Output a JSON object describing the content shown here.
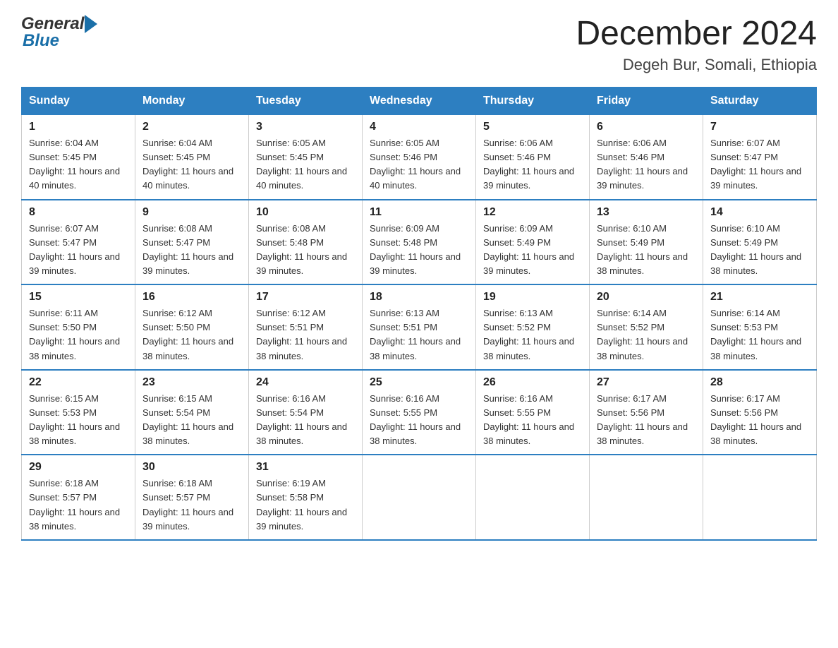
{
  "header": {
    "logo_text1": "General",
    "logo_text2": "Blue",
    "title": "December 2024",
    "subtitle": "Degeh Bur, Somali, Ethiopia"
  },
  "calendar": {
    "days_of_week": [
      "Sunday",
      "Monday",
      "Tuesday",
      "Wednesday",
      "Thursday",
      "Friday",
      "Saturday"
    ],
    "weeks": [
      [
        {
          "day": "1",
          "sunrise": "6:04 AM",
          "sunset": "5:45 PM",
          "daylight": "11 hours and 40 minutes."
        },
        {
          "day": "2",
          "sunrise": "6:04 AM",
          "sunset": "5:45 PM",
          "daylight": "11 hours and 40 minutes."
        },
        {
          "day": "3",
          "sunrise": "6:05 AM",
          "sunset": "5:45 PM",
          "daylight": "11 hours and 40 minutes."
        },
        {
          "day": "4",
          "sunrise": "6:05 AM",
          "sunset": "5:46 PM",
          "daylight": "11 hours and 40 minutes."
        },
        {
          "day": "5",
          "sunrise": "6:06 AM",
          "sunset": "5:46 PM",
          "daylight": "11 hours and 39 minutes."
        },
        {
          "day": "6",
          "sunrise": "6:06 AM",
          "sunset": "5:46 PM",
          "daylight": "11 hours and 39 minutes."
        },
        {
          "day": "7",
          "sunrise": "6:07 AM",
          "sunset": "5:47 PM",
          "daylight": "11 hours and 39 minutes."
        }
      ],
      [
        {
          "day": "8",
          "sunrise": "6:07 AM",
          "sunset": "5:47 PM",
          "daylight": "11 hours and 39 minutes."
        },
        {
          "day": "9",
          "sunrise": "6:08 AM",
          "sunset": "5:47 PM",
          "daylight": "11 hours and 39 minutes."
        },
        {
          "day": "10",
          "sunrise": "6:08 AM",
          "sunset": "5:48 PM",
          "daylight": "11 hours and 39 minutes."
        },
        {
          "day": "11",
          "sunrise": "6:09 AM",
          "sunset": "5:48 PM",
          "daylight": "11 hours and 39 minutes."
        },
        {
          "day": "12",
          "sunrise": "6:09 AM",
          "sunset": "5:49 PM",
          "daylight": "11 hours and 39 minutes."
        },
        {
          "day": "13",
          "sunrise": "6:10 AM",
          "sunset": "5:49 PM",
          "daylight": "11 hours and 38 minutes."
        },
        {
          "day": "14",
          "sunrise": "6:10 AM",
          "sunset": "5:49 PM",
          "daylight": "11 hours and 38 minutes."
        }
      ],
      [
        {
          "day": "15",
          "sunrise": "6:11 AM",
          "sunset": "5:50 PM",
          "daylight": "11 hours and 38 minutes."
        },
        {
          "day": "16",
          "sunrise": "6:12 AM",
          "sunset": "5:50 PM",
          "daylight": "11 hours and 38 minutes."
        },
        {
          "day": "17",
          "sunrise": "6:12 AM",
          "sunset": "5:51 PM",
          "daylight": "11 hours and 38 minutes."
        },
        {
          "day": "18",
          "sunrise": "6:13 AM",
          "sunset": "5:51 PM",
          "daylight": "11 hours and 38 minutes."
        },
        {
          "day": "19",
          "sunrise": "6:13 AM",
          "sunset": "5:52 PM",
          "daylight": "11 hours and 38 minutes."
        },
        {
          "day": "20",
          "sunrise": "6:14 AM",
          "sunset": "5:52 PM",
          "daylight": "11 hours and 38 minutes."
        },
        {
          "day": "21",
          "sunrise": "6:14 AM",
          "sunset": "5:53 PM",
          "daylight": "11 hours and 38 minutes."
        }
      ],
      [
        {
          "day": "22",
          "sunrise": "6:15 AM",
          "sunset": "5:53 PM",
          "daylight": "11 hours and 38 minutes."
        },
        {
          "day": "23",
          "sunrise": "6:15 AM",
          "sunset": "5:54 PM",
          "daylight": "11 hours and 38 minutes."
        },
        {
          "day": "24",
          "sunrise": "6:16 AM",
          "sunset": "5:54 PM",
          "daylight": "11 hours and 38 minutes."
        },
        {
          "day": "25",
          "sunrise": "6:16 AM",
          "sunset": "5:55 PM",
          "daylight": "11 hours and 38 minutes."
        },
        {
          "day": "26",
          "sunrise": "6:16 AM",
          "sunset": "5:55 PM",
          "daylight": "11 hours and 38 minutes."
        },
        {
          "day": "27",
          "sunrise": "6:17 AM",
          "sunset": "5:56 PM",
          "daylight": "11 hours and 38 minutes."
        },
        {
          "day": "28",
          "sunrise": "6:17 AM",
          "sunset": "5:56 PM",
          "daylight": "11 hours and 38 minutes."
        }
      ],
      [
        {
          "day": "29",
          "sunrise": "6:18 AM",
          "sunset": "5:57 PM",
          "daylight": "11 hours and 38 minutes."
        },
        {
          "day": "30",
          "sunrise": "6:18 AM",
          "sunset": "5:57 PM",
          "daylight": "11 hours and 39 minutes."
        },
        {
          "day": "31",
          "sunrise": "6:19 AM",
          "sunset": "5:58 PM",
          "daylight": "11 hours and 39 minutes."
        },
        null,
        null,
        null,
        null
      ]
    ]
  }
}
